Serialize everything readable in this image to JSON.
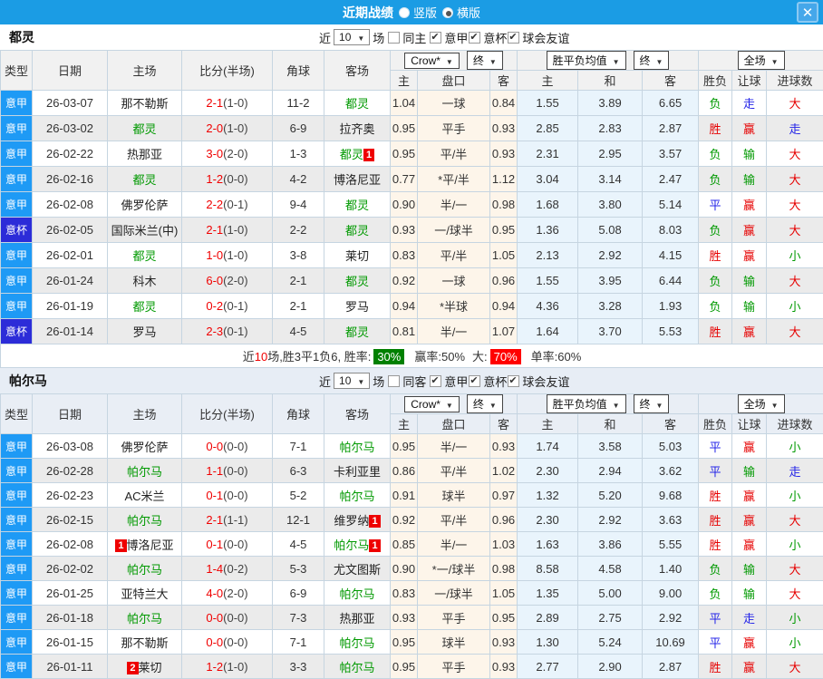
{
  "icons": {
    "close": "✕"
  },
  "colors": {
    "topbar": "#1b9ce4",
    "league_badge": "#1e9af5",
    "cup_badge": "#2c2cd8",
    "win_red": "#e60000",
    "lose_green": "#009900",
    "draw_blue": "#2424e8",
    "handicap_bg": "#fdf5ea",
    "avg_bg": "#e9f4fc",
    "red_card_badge": "#ee0000",
    "win_rate_badge": "#008000",
    "big_rate_badge": "#ff0000"
  },
  "titlebar": {
    "title": "近期战绩",
    "radio_vertical": "竖版",
    "radio_horizontal": "横版"
  },
  "columns": {
    "main": [
      "类型",
      "日期",
      "主场",
      "比分(半场)",
      "角球",
      "客场"
    ],
    "odds": [
      "主",
      "盘口",
      "客"
    ],
    "avg": [
      "主",
      "和",
      "客"
    ],
    "result": [
      "胜负",
      "让球",
      "进球数"
    ],
    "dropdowns": {
      "bookmaker": "Crow*",
      "period1": "终",
      "avg_label": "胜平负均值",
      "period2": "终",
      "scope": "全场"
    }
  },
  "sections": [
    {
      "team": "都灵",
      "filter": {
        "near_label": "近",
        "count": "10",
        "field_label": "场",
        "same_label": "同主",
        "same_checked": false,
        "leagues": [
          {
            "label": "意甲",
            "checked": true
          },
          {
            "label": "意杯",
            "checked": true
          },
          {
            "label": "球会友谊",
            "checked": true
          }
        ]
      },
      "rows": [
        {
          "type": "意甲",
          "date": "26-03-07",
          "home": "那不勒斯",
          "home_green": false,
          "home_badge": "",
          "score": "2-1",
          "half": "(1-0)",
          "corner": "11-2",
          "away": "都灵",
          "away_green": true,
          "away_badge": "",
          "odds_home": "1.04",
          "handicap": "一球",
          "odds_away": "0.84",
          "avg_home": "1.55",
          "avg_draw": "3.89",
          "avg_away": "6.65",
          "result": "负",
          "result_color": "green",
          "handicap_result": "走",
          "handicap_result_color": "blue",
          "goals": "大",
          "goals_color": "red"
        },
        {
          "type": "意甲",
          "date": "26-03-02",
          "home": "都灵",
          "home_green": true,
          "home_badge": "",
          "score": "2-0",
          "half": "(1-0)",
          "corner": "6-9",
          "away": "拉齐奥",
          "away_green": false,
          "away_badge": "",
          "odds_home": "0.95",
          "handicap": "平手",
          "odds_away": "0.93",
          "avg_home": "2.85",
          "avg_draw": "2.83",
          "avg_away": "2.87",
          "result": "胜",
          "result_color": "red",
          "handicap_result": "赢",
          "handicap_result_color": "red",
          "goals": "走",
          "goals_color": "blue"
        },
        {
          "type": "意甲",
          "date": "26-02-22",
          "home": "热那亚",
          "home_green": false,
          "home_badge": "",
          "score": "3-0",
          "half": "(2-0)",
          "corner": "1-3",
          "away": "都灵",
          "away_green": true,
          "away_badge": "1",
          "odds_home": "0.95",
          "handicap": "平/半",
          "odds_away": "0.93",
          "avg_home": "2.31",
          "avg_draw": "2.95",
          "avg_away": "3.57",
          "result": "负",
          "result_color": "green",
          "handicap_result": "输",
          "handicap_result_color": "green",
          "goals": "大",
          "goals_color": "red"
        },
        {
          "type": "意甲",
          "date": "26-02-16",
          "home": "都灵",
          "home_green": true,
          "home_badge": "",
          "score": "1-2",
          "half": "(0-0)",
          "corner": "4-2",
          "away": "博洛尼亚",
          "away_green": false,
          "away_badge": "",
          "odds_home": "0.77",
          "handicap": "*平/半",
          "odds_away": "1.12",
          "avg_home": "3.04",
          "avg_draw": "3.14",
          "avg_away": "2.47",
          "result": "负",
          "result_color": "green",
          "handicap_result": "输",
          "handicap_result_color": "green",
          "goals": "大",
          "goals_color": "red"
        },
        {
          "type": "意甲",
          "date": "26-02-08",
          "home": "佛罗伦萨",
          "home_green": false,
          "home_badge": "",
          "score": "2-2",
          "half": "(0-1)",
          "corner": "9-4",
          "away": "都灵",
          "away_green": true,
          "away_badge": "",
          "odds_home": "0.90",
          "handicap": "半/一",
          "odds_away": "0.98",
          "avg_home": "1.68",
          "avg_draw": "3.80",
          "avg_away": "5.14",
          "result": "平",
          "result_color": "blue",
          "handicap_result": "赢",
          "handicap_result_color": "red",
          "goals": "大",
          "goals_color": "red"
        },
        {
          "type": "意杯",
          "date": "26-02-05",
          "home": "国际米兰(中)",
          "home_green": false,
          "home_badge": "",
          "score": "2-1",
          "half": "(1-0)",
          "corner": "2-2",
          "away": "都灵",
          "away_green": true,
          "away_badge": "",
          "odds_home": "0.93",
          "handicap": "一/球半",
          "odds_away": "0.95",
          "avg_home": "1.36",
          "avg_draw": "5.08",
          "avg_away": "8.03",
          "result": "负",
          "result_color": "green",
          "handicap_result": "赢",
          "handicap_result_color": "red",
          "goals": "大",
          "goals_color": "red"
        },
        {
          "type": "意甲",
          "date": "26-02-01",
          "home": "都灵",
          "home_green": true,
          "home_badge": "",
          "score": "1-0",
          "half": "(1-0)",
          "corner": "3-8",
          "away": "莱切",
          "away_green": false,
          "away_badge": "",
          "odds_home": "0.83",
          "handicap": "平/半",
          "odds_away": "1.05",
          "avg_home": "2.13",
          "avg_draw": "2.92",
          "avg_away": "4.15",
          "result": "胜",
          "result_color": "red",
          "handicap_result": "赢",
          "handicap_result_color": "red",
          "goals": "小",
          "goals_color": "green"
        },
        {
          "type": "意甲",
          "date": "26-01-24",
          "home": "科木",
          "home_green": false,
          "home_badge": "",
          "score": "6-0",
          "half": "(2-0)",
          "corner": "2-1",
          "away": "都灵",
          "away_green": true,
          "away_badge": "",
          "odds_home": "0.92",
          "handicap": "一球",
          "odds_away": "0.96",
          "avg_home": "1.55",
          "avg_draw": "3.95",
          "avg_away": "6.44",
          "result": "负",
          "result_color": "green",
          "handicap_result": "输",
          "handicap_result_color": "green",
          "goals": "大",
          "goals_color": "red"
        },
        {
          "type": "意甲",
          "date": "26-01-19",
          "home": "都灵",
          "home_green": true,
          "home_badge": "",
          "score": "0-2",
          "half": "(0-1)",
          "corner": "2-1",
          "away": "罗马",
          "away_green": false,
          "away_badge": "",
          "odds_home": "0.94",
          "handicap": "*半球",
          "odds_away": "0.94",
          "avg_home": "4.36",
          "avg_draw": "3.28",
          "avg_away": "1.93",
          "result": "负",
          "result_color": "green",
          "handicap_result": "输",
          "handicap_result_color": "green",
          "goals": "小",
          "goals_color": "green"
        },
        {
          "type": "意杯",
          "date": "26-01-14",
          "home": "罗马",
          "home_green": false,
          "home_badge": "",
          "score": "2-3",
          "half": "(0-1)",
          "corner": "4-5",
          "away": "都灵",
          "away_green": true,
          "away_badge": "",
          "odds_home": "0.81",
          "handicap": "半/一",
          "odds_away": "1.07",
          "avg_home": "1.64",
          "avg_draw": "3.70",
          "avg_away": "5.53",
          "result": "胜",
          "result_color": "red",
          "handicap_result": "赢",
          "handicap_result_color": "red",
          "goals": "大",
          "goals_color": "red"
        }
      ],
      "summary": {
        "near_label": "近",
        "count": "10",
        "text1": "场,胜3平1负6, 胜率:",
        "win_badge": "30%",
        "text2": "赢率:",
        "win_rate": "50%",
        "text3": "大:",
        "big_badge": "70%",
        "text4": "单率:",
        "single_rate": "60%"
      }
    },
    {
      "team": "帕尔马",
      "filter": {
        "near_label": "近",
        "count": "10",
        "field_label": "场",
        "same_label": "同客",
        "same_checked": false,
        "leagues": [
          {
            "label": "意甲",
            "checked": true
          },
          {
            "label": "意杯",
            "checked": true
          },
          {
            "label": "球会友谊",
            "checked": true
          }
        ]
      },
      "rows": [
        {
          "type": "意甲",
          "date": "26-03-08",
          "home": "佛罗伦萨",
          "home_green": false,
          "home_badge": "",
          "score": "0-0",
          "half": "(0-0)",
          "corner": "7-1",
          "away": "帕尔马",
          "away_green": true,
          "away_badge": "",
          "odds_home": "0.95",
          "handicap": "半/一",
          "odds_away": "0.93",
          "avg_home": "1.74",
          "avg_draw": "3.58",
          "avg_away": "5.03",
          "result": "平",
          "result_color": "blue",
          "handicap_result": "赢",
          "handicap_result_color": "red",
          "goals": "小",
          "goals_color": "green"
        },
        {
          "type": "意甲",
          "date": "26-02-28",
          "home": "帕尔马",
          "home_green": true,
          "home_badge": "",
          "score": "1-1",
          "half": "(0-0)",
          "corner": "6-3",
          "away": "卡利亚里",
          "away_green": false,
          "away_badge": "",
          "odds_home": "0.86",
          "handicap": "平/半",
          "odds_away": "1.02",
          "avg_home": "2.30",
          "avg_draw": "2.94",
          "avg_away": "3.62",
          "result": "平",
          "result_color": "blue",
          "handicap_result": "输",
          "handicap_result_color": "green",
          "goals": "走",
          "goals_color": "blue"
        },
        {
          "type": "意甲",
          "date": "26-02-23",
          "home": "AC米兰",
          "home_green": false,
          "home_badge": "",
          "score": "0-1",
          "half": "(0-0)",
          "corner": "5-2",
          "away": "帕尔马",
          "away_green": true,
          "away_badge": "",
          "odds_home": "0.91",
          "handicap": "球半",
          "odds_away": "0.97",
          "avg_home": "1.32",
          "avg_draw": "5.20",
          "avg_away": "9.68",
          "result": "胜",
          "result_color": "red",
          "handicap_result": "赢",
          "handicap_result_color": "red",
          "goals": "小",
          "goals_color": "green"
        },
        {
          "type": "意甲",
          "date": "26-02-15",
          "home": "帕尔马",
          "home_green": true,
          "home_badge": "",
          "score": "2-1",
          "half": "(1-1)",
          "corner": "12-1",
          "away": "维罗纳",
          "away_green": false,
          "away_badge": "1",
          "odds_home": "0.92",
          "handicap": "平/半",
          "odds_away": "0.96",
          "avg_home": "2.30",
          "avg_draw": "2.92",
          "avg_away": "3.63",
          "result": "胜",
          "result_color": "red",
          "handicap_result": "赢",
          "handicap_result_color": "red",
          "goals": "大",
          "goals_color": "red"
        },
        {
          "type": "意甲",
          "date": "26-02-08",
          "home": "博洛尼亚",
          "home_green": false,
          "home_badge": "1",
          "score": "0-1",
          "half": "(0-0)",
          "corner": "4-5",
          "away": "帕尔马",
          "away_green": true,
          "away_badge": "1",
          "odds_home": "0.85",
          "handicap": "半/一",
          "odds_away": "1.03",
          "avg_home": "1.63",
          "avg_draw": "3.86",
          "avg_away": "5.55",
          "result": "胜",
          "result_color": "red",
          "handicap_result": "赢",
          "handicap_result_color": "red",
          "goals": "小",
          "goals_color": "green"
        },
        {
          "type": "意甲",
          "date": "26-02-02",
          "home": "帕尔马",
          "home_green": true,
          "home_badge": "",
          "score": "1-4",
          "half": "(0-2)",
          "corner": "5-3",
          "away": "尤文图斯",
          "away_green": false,
          "away_badge": "",
          "odds_home": "0.90",
          "handicap": "*一/球半",
          "odds_away": "0.98",
          "avg_home": "8.58",
          "avg_draw": "4.58",
          "avg_away": "1.40",
          "result": "负",
          "result_color": "green",
          "handicap_result": "输",
          "handicap_result_color": "green",
          "goals": "大",
          "goals_color": "red"
        },
        {
          "type": "意甲",
          "date": "26-01-25",
          "home": "亚特兰大",
          "home_green": false,
          "home_badge": "",
          "score": "4-0",
          "half": "(2-0)",
          "corner": "6-9",
          "away": "帕尔马",
          "away_green": true,
          "away_badge": "",
          "odds_home": "0.83",
          "handicap": "一/球半",
          "odds_away": "1.05",
          "avg_home": "1.35",
          "avg_draw": "5.00",
          "avg_away": "9.00",
          "result": "负",
          "result_color": "green",
          "handicap_result": "输",
          "handicap_result_color": "green",
          "goals": "大",
          "goals_color": "red"
        },
        {
          "type": "意甲",
          "date": "26-01-18",
          "home": "帕尔马",
          "home_green": true,
          "home_badge": "",
          "score": "0-0",
          "half": "(0-0)",
          "corner": "7-3",
          "away": "热那亚",
          "away_green": false,
          "away_badge": "",
          "odds_home": "0.93",
          "handicap": "平手",
          "odds_away": "0.95",
          "avg_home": "2.89",
          "avg_draw": "2.75",
          "avg_away": "2.92",
          "result": "平",
          "result_color": "blue",
          "handicap_result": "走",
          "handicap_result_color": "blue",
          "goals": "小",
          "goals_color": "green"
        },
        {
          "type": "意甲",
          "date": "26-01-15",
          "home": "那不勒斯",
          "home_green": false,
          "home_badge": "",
          "score": "0-0",
          "half": "(0-0)",
          "corner": "7-1",
          "away": "帕尔马",
          "away_green": true,
          "away_badge": "",
          "odds_home": "0.95",
          "handicap": "球半",
          "odds_away": "0.93",
          "avg_home": "1.30",
          "avg_draw": "5.24",
          "avg_away": "10.69",
          "result": "平",
          "result_color": "blue",
          "handicap_result": "赢",
          "handicap_result_color": "red",
          "goals": "小",
          "goals_color": "green"
        },
        {
          "type": "意甲",
          "date": "26-01-11",
          "home": "莱切",
          "home_green": false,
          "home_badge": "2",
          "score": "1-2",
          "half": "(1-0)",
          "corner": "3-3",
          "away": "帕尔马",
          "away_green": true,
          "away_badge": "",
          "odds_home": "0.95",
          "handicap": "平手",
          "odds_away": "0.93",
          "avg_home": "2.77",
          "avg_draw": "2.90",
          "avg_away": "2.87",
          "result": "胜",
          "result_color": "red",
          "handicap_result": "赢",
          "handicap_result_color": "red",
          "goals": "大",
          "goals_color": "red"
        }
      ]
    }
  ]
}
